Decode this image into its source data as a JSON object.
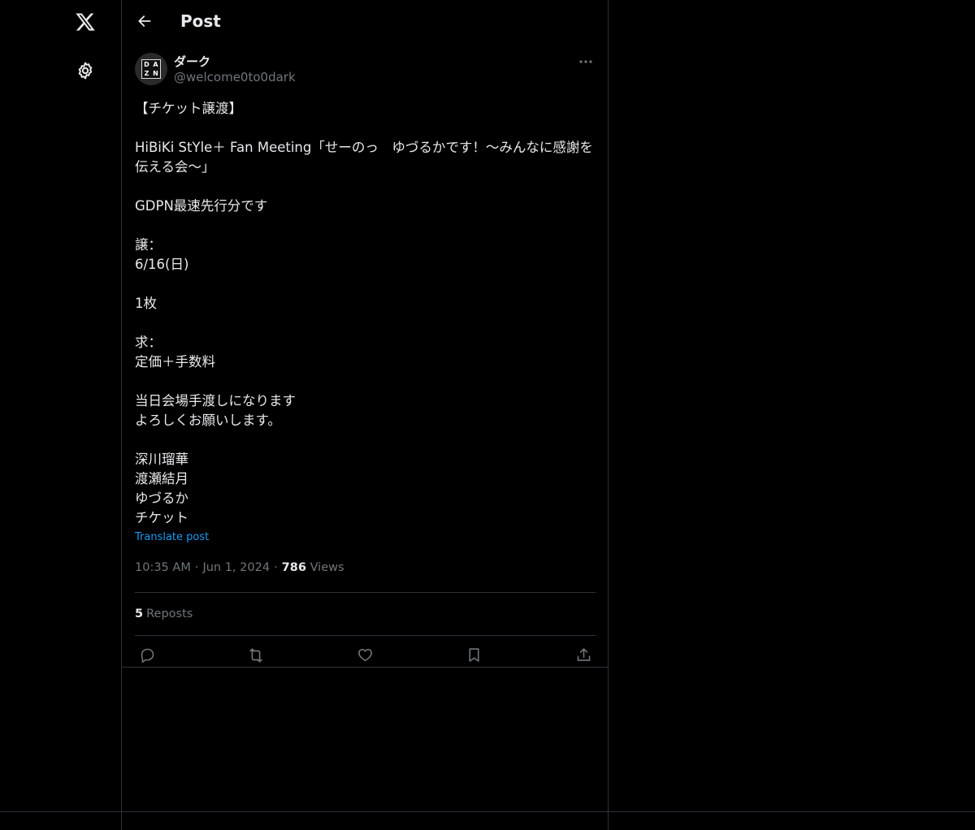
{
  "nav": {
    "items": [
      {
        "icon": "x-logo-icon"
      },
      {
        "icon": "gear-icon"
      }
    ]
  },
  "header": {
    "title": "Post"
  },
  "post": {
    "author": {
      "display_name": "ダーク",
      "handle": "@welcome0to0dark",
      "avatar_text": [
        "DA",
        "ZN"
      ]
    },
    "body": "【チケット譲渡】\n\nHiBiKi StYle＋ Fan Meeting「せーのっ　ゆづるかです！〜みんなに感謝を伝える会〜」\n\nGDPN最速先行分です\n\n譲：\n6/16(日)\n\n1枚\n\n求：\n定価＋手数料\n\n当日会場手渡しになります\nよろしくお願いします。\n\n深川瑠華\n渡瀬結月\nゆづるか\nチケット",
    "translate_label": "Translate post",
    "time": "10:35 AM",
    "date": "Jun 1, 2024",
    "views_count": "786",
    "views_label": "Views",
    "reposts_count": "5",
    "reposts_label": "Reposts"
  },
  "colors": {
    "background": "#000000",
    "text": "#e7e9ea",
    "muted": "#71767b",
    "accent": "#1d9bf0",
    "border": "#2f3336"
  }
}
